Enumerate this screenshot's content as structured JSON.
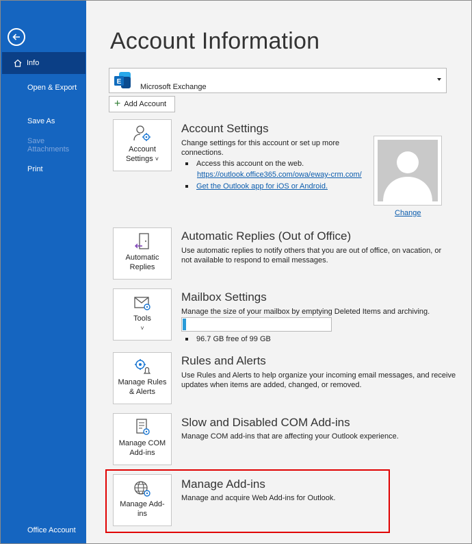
{
  "sidebar": {
    "items": [
      {
        "label": "Info"
      },
      {
        "label": "Open & Export"
      },
      {
        "label": "Save As"
      },
      {
        "label": "Save Attachments"
      },
      {
        "label": "Print"
      },
      {
        "label": "Office Account"
      }
    ]
  },
  "page": {
    "title": "Account Information"
  },
  "account": {
    "name": "Microsoft Exchange",
    "add_label": "Add Account"
  },
  "account_settings": {
    "tile_line1": "Account",
    "tile_line2": "Settings",
    "caret": "˅",
    "title": "Account Settings",
    "desc_line1": "Change settings for this account or set up more",
    "desc_line2": "connections.",
    "bullet1": "Access this account on the web.",
    "link1": "https://outlook.office365.com/owa/eway-crm.com/",
    "link2": "Get the Outlook app for iOS or Android.",
    "change_label": "Change"
  },
  "auto_replies": {
    "tile_line1": "Automatic",
    "tile_line2": "Replies",
    "title": "Automatic Replies (Out of Office)",
    "desc_line1": "Use automatic replies to notify others that you are out of office, on vacation, or",
    "desc_line2": "not available to respond to email messages."
  },
  "mailbox": {
    "tile_line1": "Tools",
    "caret": "˅",
    "title": "Mailbox Settings",
    "desc": "Manage the size of your mailbox by emptying Deleted Items and archiving.",
    "usage_fraction": 0.025,
    "free_text": "96.7 GB free of 99 GB",
    "bar_color": "#2b9bd8"
  },
  "rules": {
    "tile_line1": "Manage Rules",
    "tile_line2": "& Alerts",
    "title": "Rules and Alerts",
    "desc_line1": "Use Rules and Alerts to help organize your incoming email messages, and receive",
    "desc_line2": "updates when items are added, changed, or removed."
  },
  "com_addins": {
    "tile_line1": "Manage COM",
    "tile_line2": "Add-ins",
    "title": "Slow and Disabled COM Add-ins",
    "desc": "Manage COM add-ins that are affecting your Outlook experience."
  },
  "web_addins": {
    "tile_line1": "Manage Add-",
    "tile_line2": "ins",
    "title": "Manage Add-ins",
    "desc": "Manage and acquire Web Add-ins for Outlook."
  },
  "colors": {
    "sidebar": "#1565c0",
    "sidebar_active": "#0b3f86",
    "highlight": "#e00000",
    "link": "#0b5cad"
  }
}
